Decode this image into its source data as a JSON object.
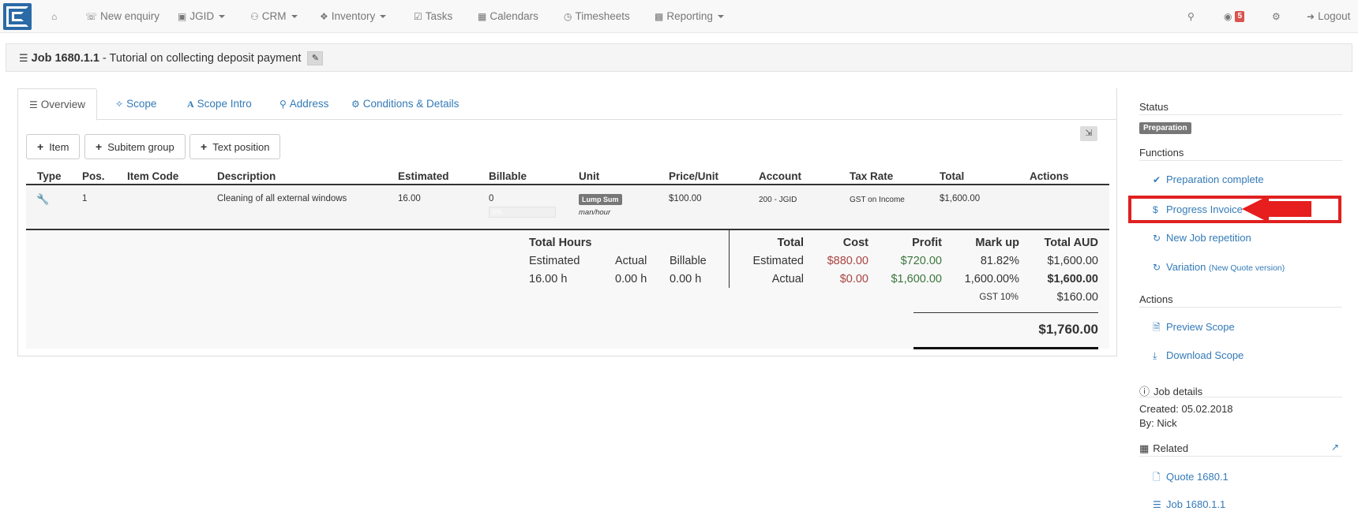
{
  "navbar": {
    "items": [
      {
        "icon": "home-icon",
        "label": ""
      },
      {
        "icon": "phone-icon",
        "label": "New enquiry"
      },
      {
        "icon": "jgid-icon",
        "label": "JGID"
      },
      {
        "icon": "users-icon",
        "label": "CRM"
      },
      {
        "icon": "cubes-icon",
        "label": "Inventory"
      },
      {
        "icon": "check-square-icon",
        "label": "Tasks"
      },
      {
        "icon": "calendar-icon",
        "label": "Calendars"
      },
      {
        "icon": "clock-icon",
        "label": "Timesheets"
      },
      {
        "icon": "bar-chart-icon",
        "label": "Reporting"
      }
    ],
    "notifications_count": "5",
    "logout_label": "Logout"
  },
  "page": {
    "job_number": "Job 1680.1.1",
    "job_title": " - Tutorial on collecting deposit payment"
  },
  "tabs": [
    "Overview",
    "Scope",
    "Scope Intro",
    "Address",
    "Conditions & Details"
  ],
  "buttons": {
    "item": "Item",
    "subitem_group": "Subitem group",
    "text_position": "Text position"
  },
  "table": {
    "headers": [
      "Type",
      "Pos.",
      "Item Code",
      "Description",
      "Estimated",
      "Billable",
      "Unit",
      "Price/Unit",
      "Account",
      "Tax Rate",
      "Total",
      "Actions"
    ],
    "row": {
      "pos": "1",
      "item_code": "",
      "description": "Cleaning of all external windows",
      "estimated": "16.00",
      "billable": "0",
      "billable_progress": "0%",
      "unit_badge": "Lump Sum",
      "unit_sub": "man/hour",
      "price_unit": "$100.00",
      "account": "200 - JGID",
      "tax_rate": "GST on Income",
      "total": "$1,600.00"
    }
  },
  "summary": {
    "hours_title": "Total Hours",
    "hours_headers": [
      "Estimated",
      "Actual",
      "Billable"
    ],
    "hours_values": [
      "16.00 h",
      "0.00 h",
      "0.00 h"
    ],
    "fin_headers": [
      "Total",
      "Cost",
      "Profit",
      "Mark up",
      "Total AUD"
    ],
    "estimated_row": {
      "label": "Estimated",
      "cost": "$880.00",
      "profit": "$720.00",
      "markup": "81.82%",
      "total": "$1,600.00"
    },
    "actual_row": {
      "label": "Actual",
      "cost": "$0.00",
      "profit": "$1,600.00",
      "markup": "1,600.00%",
      "total": "$1,600.00"
    },
    "gst_label": "GST 10%",
    "gst_value": "$160.00",
    "grand_total": "$1,760.00"
  },
  "sidebar": {
    "status_label": "Status",
    "status_value": "Preparation",
    "functions_label": "Functions",
    "functions": {
      "prep_complete": "Preparation complete",
      "progress_invoice": "Progress Invoice",
      "new_job_repetition": "New Job repetition",
      "variation": "Variation",
      "variation_note": "(New Quote version)"
    },
    "actions_label": "Actions",
    "actions": {
      "preview_scope": "Preview Scope",
      "download_scope": "Download Scope"
    },
    "job_details_label": "Job details",
    "created": "Created: 05.02.2018",
    "by": "By: Nick",
    "related_label": "Related",
    "related": {
      "quote": "Quote 1680.1",
      "job": "Job 1680.1.1"
    }
  },
  "colors": {
    "link": "#337ab7",
    "highlight": "#e02020",
    "cost_red": "#a94442",
    "profit_green": "#3c763d"
  }
}
